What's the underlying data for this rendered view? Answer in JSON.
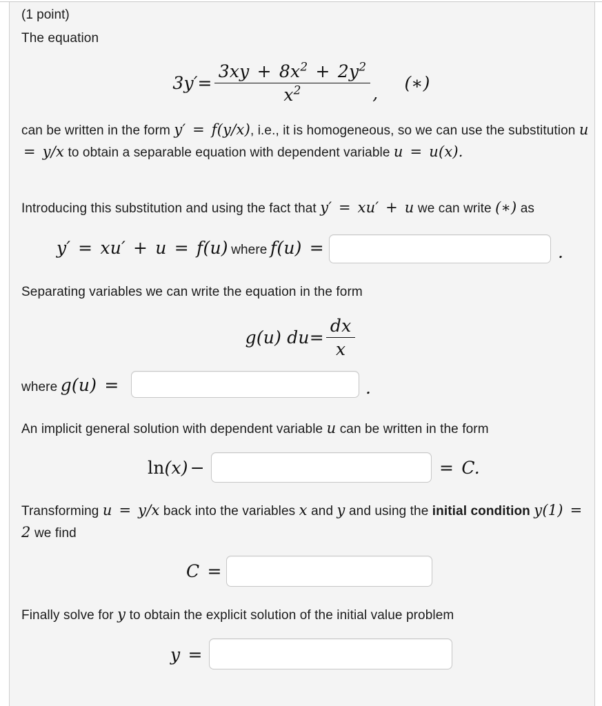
{
  "problem": {
    "points_label": "(1 point)",
    "intro_line": "The equation",
    "star_label": "(∗)",
    "main_equation": {
      "lhs": "3y′",
      "relation": "=",
      "numerator": "3xy + 8x² + 2y²",
      "denominator": "x²",
      "trailing_comma": ",",
      "tag": "(∗)"
    },
    "paragraph_homogeneous_1": "can be written in the form",
    "paragraph_homogeneous_math_1": "y′ = f(y/x)",
    "paragraph_homogeneous_2": ", i.e., it is homogeneous, so we can use the substitution",
    "paragraph_homogeneous_math_2": "u = y/x",
    "paragraph_homogeneous_3": "to obtain a separable equation with dependent variable",
    "paragraph_homogeneous_math_3": "u = u(x).",
    "paragraph_introducing_1": "Introducing this substitution and using the fact that",
    "paragraph_introducing_math": "y′ = xu′ + u",
    "paragraph_introducing_2": "we can write",
    "paragraph_introducing_star": "(∗)",
    "paragraph_introducing_3": "as",
    "fu_line_math": "y′ = xu′ + u = f(u)",
    "fu_line_where": "where",
    "fu_line_label": "f(u) =",
    "fu_line_period": ".",
    "separating_text": "Separating variables we can write the equation in the form",
    "separable_equation": {
      "lhs": "g(u) du",
      "relation": "=",
      "numerator": "dx",
      "denominator": "x"
    },
    "gu_line_where": "where",
    "gu_line_label": "g(u) =",
    "gu_line_period": ".",
    "implicit_text_1": "An implicit general solution with dependent variable",
    "implicit_text_math": "u",
    "implicit_text_2": "can be written in the form",
    "implicit_line": {
      "lhs": "ln(x)−",
      "rhs": "= C."
    },
    "transform_1": "Transforming",
    "transform_math_1": "u = y/x",
    "transform_2": "back into the variables",
    "transform_math_x": "x",
    "transform_and": "and",
    "transform_math_y": "y",
    "transform_3": "and using the",
    "transform_bold": "initial condition",
    "transform_math_ic": "y(1) = 2",
    "transform_4": "we find",
    "c_line_label": "C =",
    "finally_text_1": "Finally solve for",
    "finally_math_y": "y",
    "finally_text_2": "to obtain the explicit solution of the initial value problem",
    "y_line_label": "y ="
  },
  "answers": {
    "f_of_u": {
      "value": "",
      "placeholder": ""
    },
    "g_of_u": {
      "value": "",
      "placeholder": ""
    },
    "implicit": {
      "value": "",
      "placeholder": ""
    },
    "constant_C": {
      "value": "",
      "placeholder": ""
    },
    "explicit_y": {
      "value": "",
      "placeholder": ""
    }
  },
  "colors": {
    "page_background": "#ffffff",
    "panel_background": "#f4f4f4",
    "panel_border": "#cfcfcf",
    "text": "#1a1a1a",
    "input_border": "#c6c6c6",
    "input_background": "#ffffff"
  }
}
